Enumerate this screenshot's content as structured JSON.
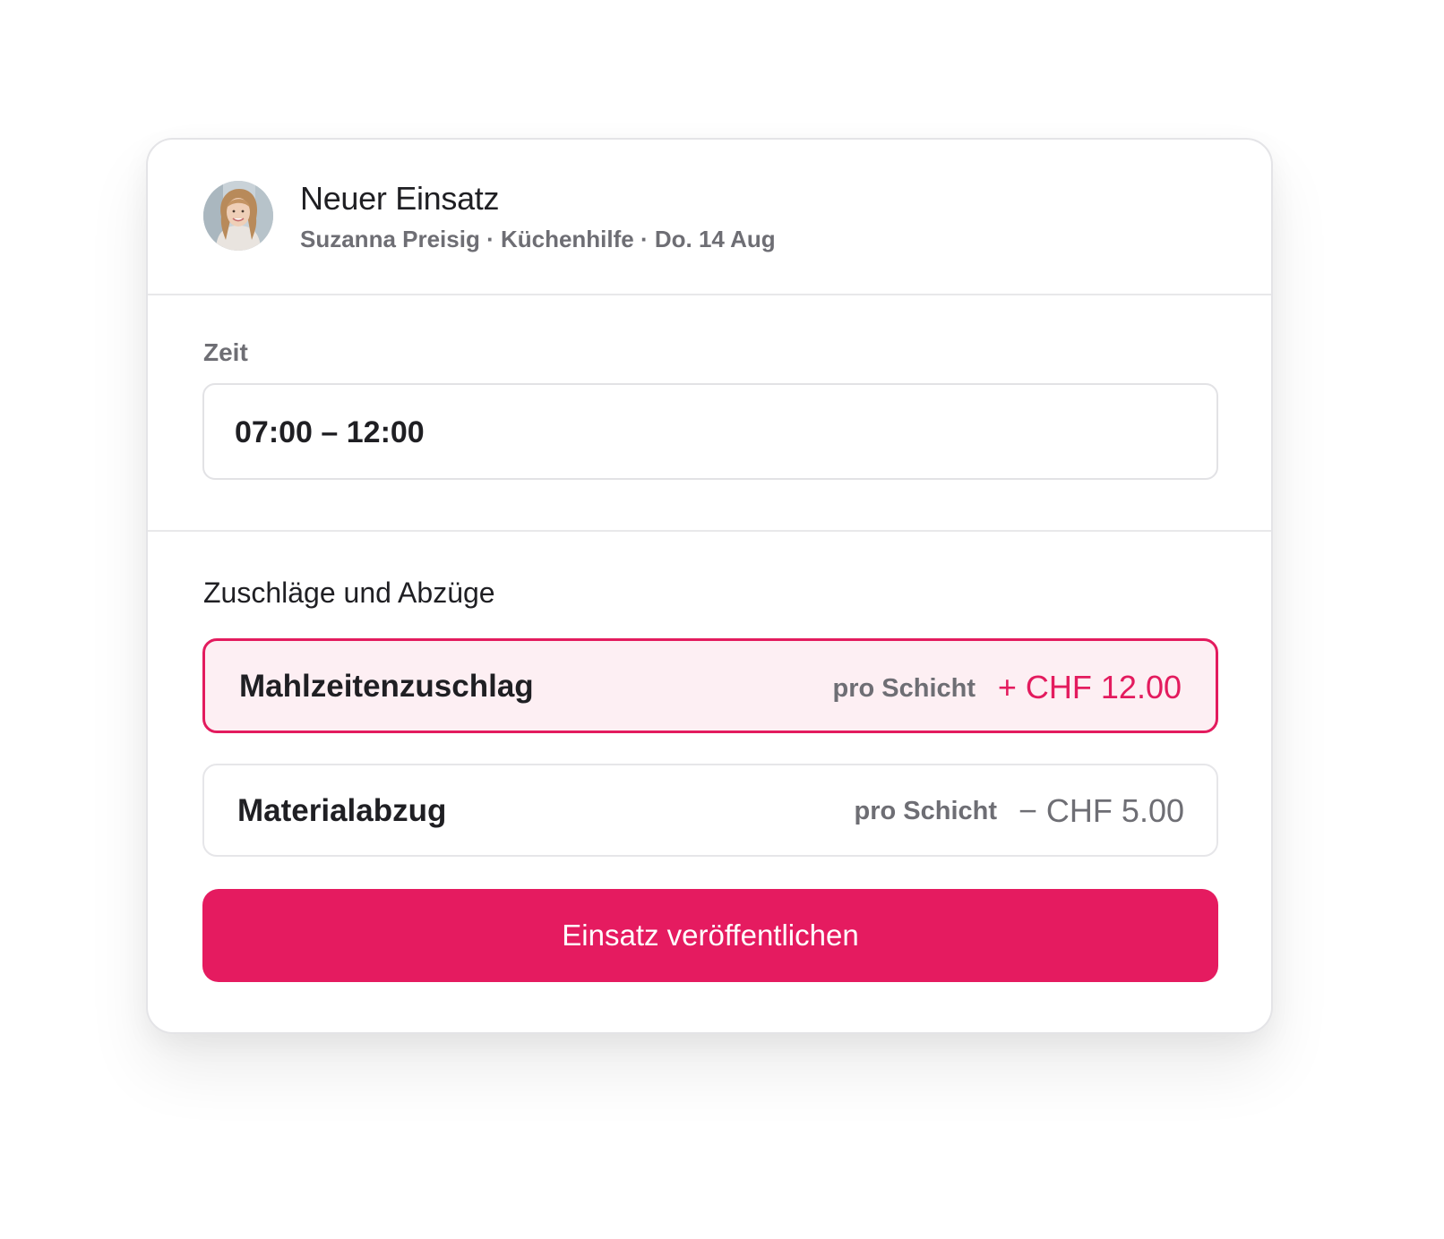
{
  "header": {
    "title": "Neuer Einsatz",
    "subtitle": "Suzanna Preisig · Küchenhilfe · Do. 14 Aug"
  },
  "time": {
    "label": "Zeit",
    "value": "07:00 – 12:00"
  },
  "adjustments": {
    "title": "Zuschläge und Abzüge",
    "items": [
      {
        "name": "Mahlzeitenzuschlag",
        "unit": "pro Schicht",
        "amount": "+ CHF 12.00",
        "selected": true
      },
      {
        "name": "Materialabzug",
        "unit": "pro Schicht",
        "amount": "− CHF 5.00",
        "selected": false
      }
    ]
  },
  "actions": {
    "publish_label": "Einsatz veröffentlichen"
  },
  "colors": {
    "accent": "#e51b60",
    "selected_bg": "#fdeff3",
    "muted_text": "#6e6e74"
  }
}
